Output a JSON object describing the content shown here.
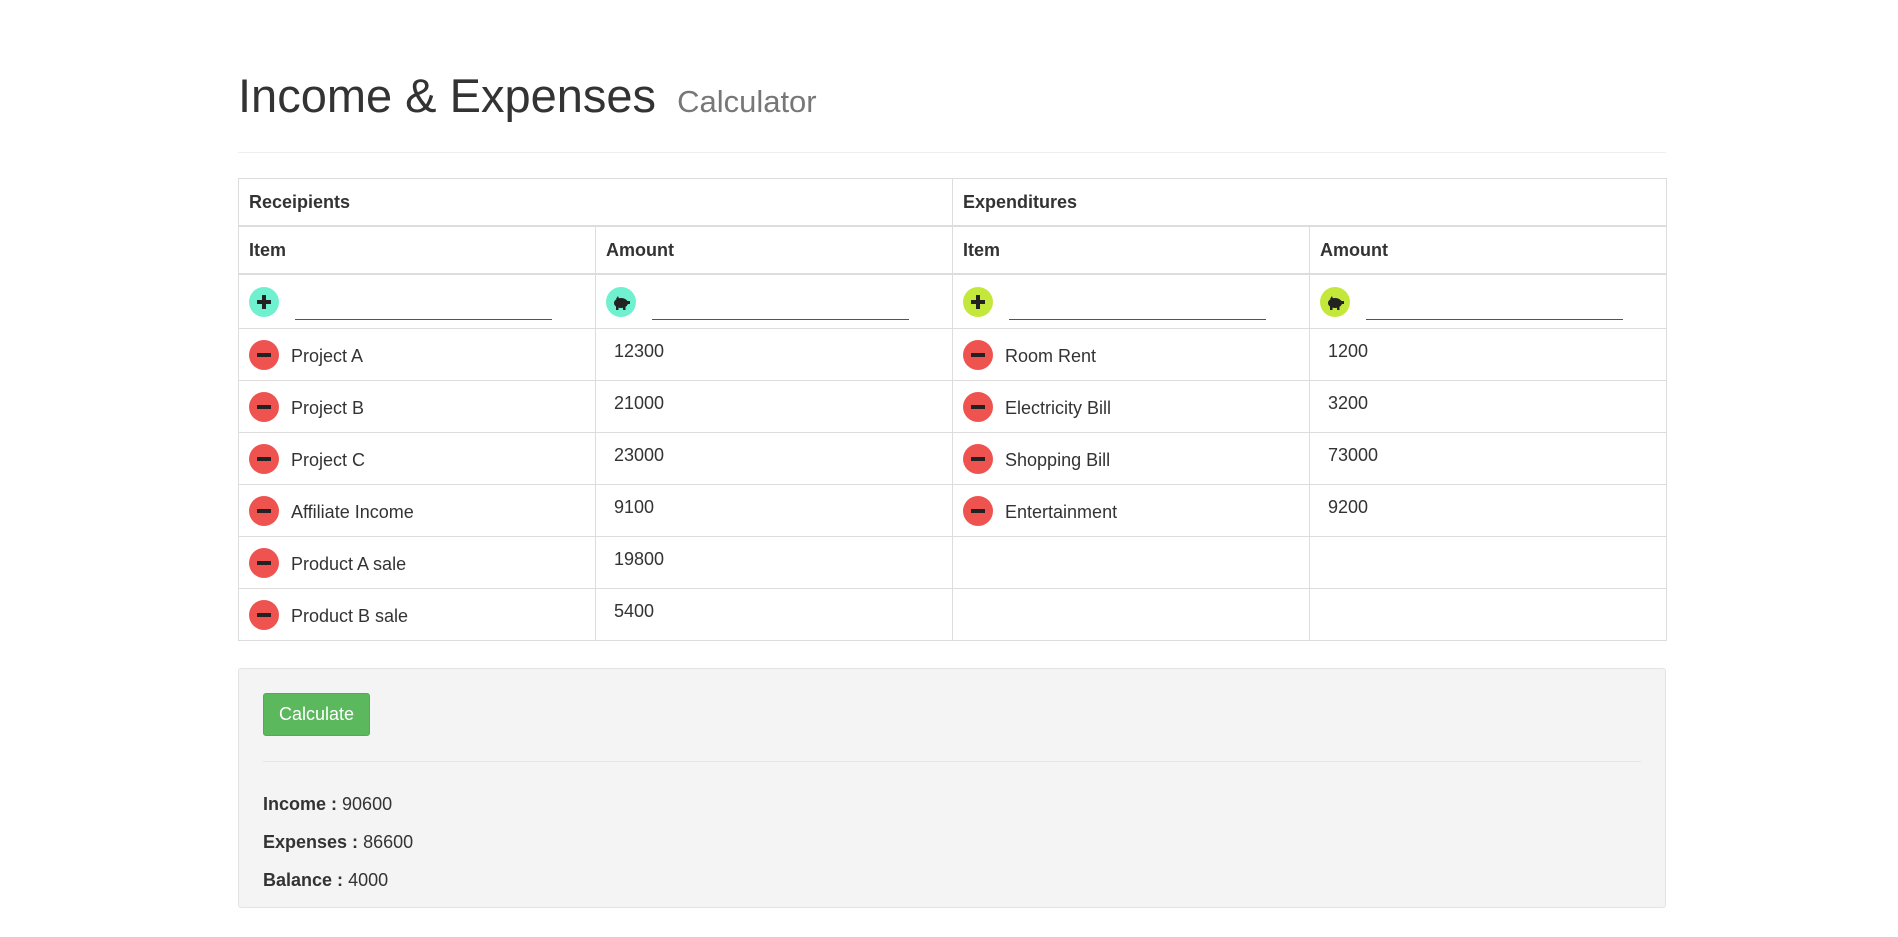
{
  "header": {
    "title": "Income & Expenses",
    "subtitle": "Calculator"
  },
  "receipts": {
    "section_label": "Receipients",
    "item_col": "Item",
    "amount_col": "Amount",
    "add_icon": "plus-icon",
    "amount_icon": "piggy-bank-icon",
    "accent": "#6ff0cf",
    "rows": [
      {
        "item": "Project A",
        "amount": "12300"
      },
      {
        "item": "Project B",
        "amount": "21000"
      },
      {
        "item": "Project C",
        "amount": "23000"
      },
      {
        "item": "Affiliate Income",
        "amount": "9100"
      },
      {
        "item": "Product A sale",
        "amount": "19800"
      },
      {
        "item": "Product B sale",
        "amount": "5400"
      }
    ]
  },
  "expenditures": {
    "section_label": "Expenditures",
    "item_col": "Item",
    "amount_col": "Amount",
    "add_icon": "plus-icon",
    "amount_icon": "piggy-bank-icon",
    "accent": "#c3e83b",
    "rows": [
      {
        "item": "Room Rent",
        "amount": "1200"
      },
      {
        "item": "Electricity Bill",
        "amount": "3200"
      },
      {
        "item": "Shopping Bill",
        "amount": "73000"
      },
      {
        "item": "Entertainment",
        "amount": "9200"
      }
    ]
  },
  "remove_icon": "minus-icon",
  "remove_color": "#ef5350",
  "results": {
    "button_label": "Calculate",
    "button_color": "#5cb85c",
    "income_label": "Income :",
    "income_value": "90600",
    "expenses_label": "Expenses :",
    "expenses_value": "86600",
    "balance_label": "Balance :",
    "balance_value": "4000"
  }
}
